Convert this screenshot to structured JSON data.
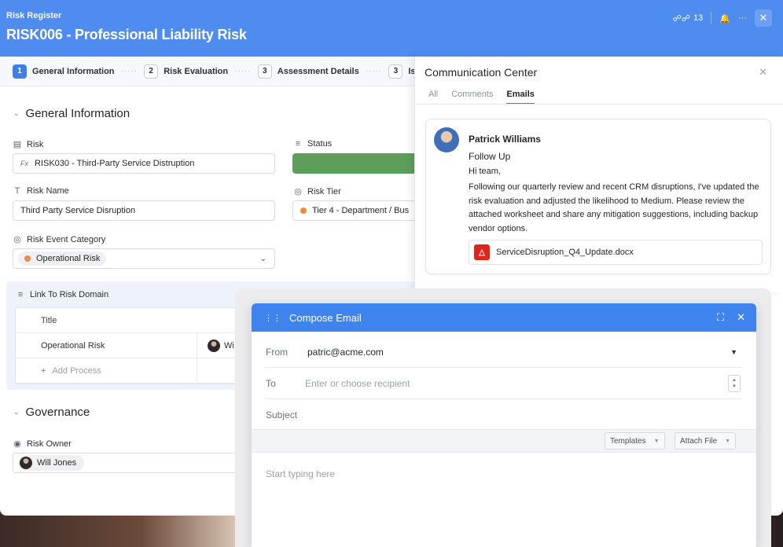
{
  "header": {
    "breadcrumb": "Risk Register",
    "title": "RISK006 - Professional Liability Risk",
    "notif_count": "13"
  },
  "steps": [
    {
      "num": "1",
      "label": "General Information"
    },
    {
      "num": "2",
      "label": "Risk Evaluation"
    },
    {
      "num": "3",
      "label": "Assessment Details"
    },
    {
      "num": "3",
      "label": "Is"
    }
  ],
  "general": {
    "section_title": "General Information",
    "risk_label": "Risk",
    "risk_fx": "Fx",
    "risk_value": "RISK030 - Third-Party Service Distruption",
    "status_label": "Status",
    "risk_name_label": "Risk Name",
    "risk_name_value": "Third Party Service Disruption",
    "risk_tier_label": "Risk Tier",
    "risk_tier_value": "Tier 4 - Department / Bus",
    "event_category_label": "Risk Event Category",
    "event_category_value": "Operational Risk",
    "link_domain_label": "Link To Risk Domain",
    "table_header": "Title",
    "table_row_title": "Operational Risk",
    "table_row_owner": "Wi",
    "add_process": "Add Process"
  },
  "governance": {
    "section_title": "Governance",
    "owner_label": "Risk Owner",
    "owner_value": "Will Jones"
  },
  "comm": {
    "title": "Communication Center",
    "tabs": [
      "All",
      "Comments",
      "Emails"
    ],
    "sender": "Patrick Williams",
    "subject": "Follow Up",
    "greeting": "Hi team,",
    "body": "Following our quarterly review and recent CRM disruptions, I've updated the risk evaluation and adjusted the likelihood to Medium. Please review the attached worksheet and share any mitigation suggestions, including backup vendor options.",
    "attachment": "ServiceDisruption_Q4_Update.docx"
  },
  "compose": {
    "title": "Compose Email",
    "from_label": "From",
    "from_value": "patric@acme.com",
    "to_label": "To",
    "to_placeholder": "Enter or choose recipient",
    "subject_label": "Subject",
    "templates_label": "Templates",
    "attach_label": "Attach File",
    "body_placeholder": "Start typing here"
  },
  "colors": {
    "header": "#4e8cf0",
    "accent": "#3f7fe8",
    "status_green": "#5d9e5a",
    "tier_dot": "#f08a3c",
    "pdf_red": "#e2231a"
  },
  "icons": [
    "binoculars-icon",
    "bell-icon",
    "more-icon",
    "close-icon",
    "caret-icon",
    "list-icon",
    "lines-icon",
    "text-t-icon",
    "target-icon",
    "link-icon",
    "user-circle-icon",
    "plus-icon",
    "pdf-icon",
    "grip-icon",
    "expand-icon",
    "chevron-down-icon"
  ]
}
